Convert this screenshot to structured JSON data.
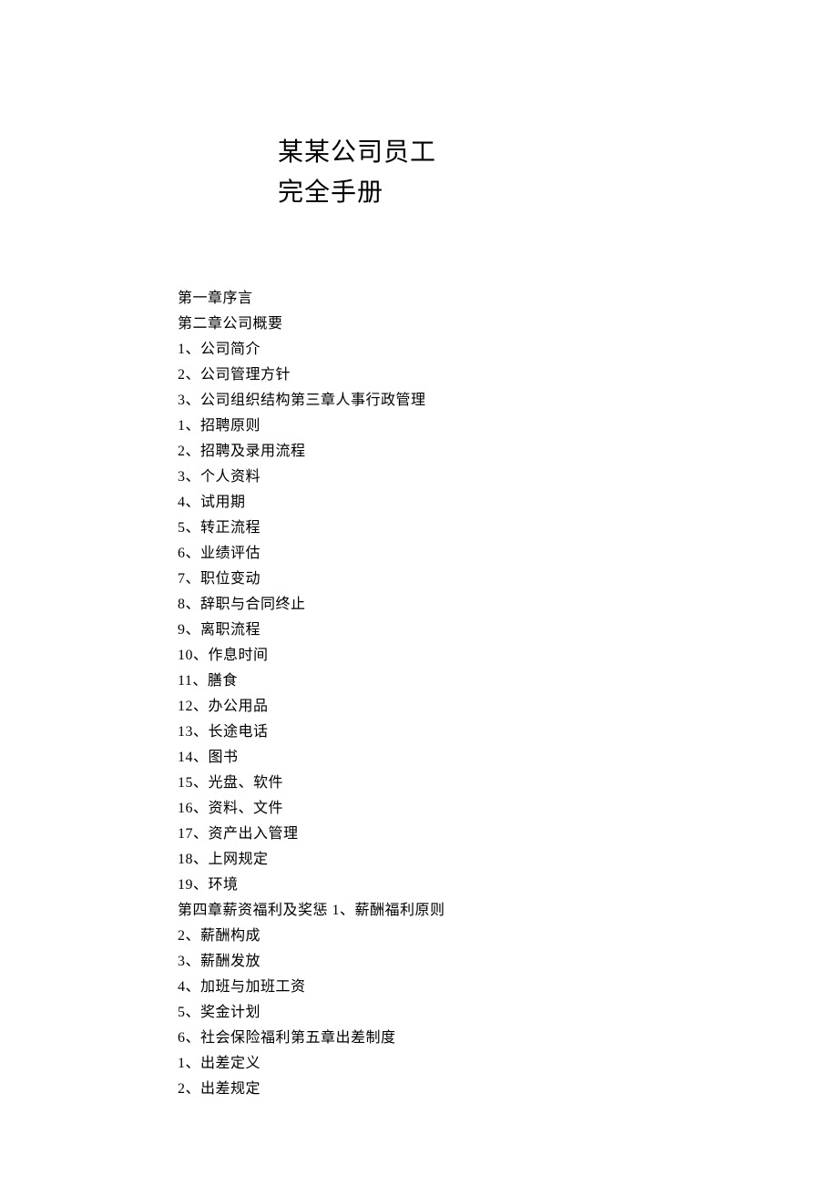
{
  "title": {
    "line1": "某某公司员工",
    "line2": "完全手册"
  },
  "toc": [
    "第一章序言",
    "第二章公司概要",
    "1、公司简介",
    "2、公司管理方针",
    "3、公司组织结构第三章人事行政管理",
    "1、招聘原则",
    "2、招聘及录用流程",
    "3、个人资料",
    "4、试用期",
    "5、转正流程",
    "6、业绩评估",
    "7、职位变动",
    "8、辞职与合同终止",
    "9、离职流程",
    "10、作息时间",
    "11、膳食",
    "12、办公用品",
    "13、长途电话",
    "14、图书",
    "15、光盘、软件",
    "16、资料、文件",
    "17、资产出入管理",
    "18、上网规定",
    "19、环境",
    "第四章薪资福利及奖惩 1、薪酬福利原则",
    "2、薪酬构成",
    "3、薪酬发放",
    "4、加班与加班工资",
    "5、奖金计划",
    "6、社会保险福利第五章出差制度",
    "1、出差定义",
    "2、出差规定"
  ]
}
